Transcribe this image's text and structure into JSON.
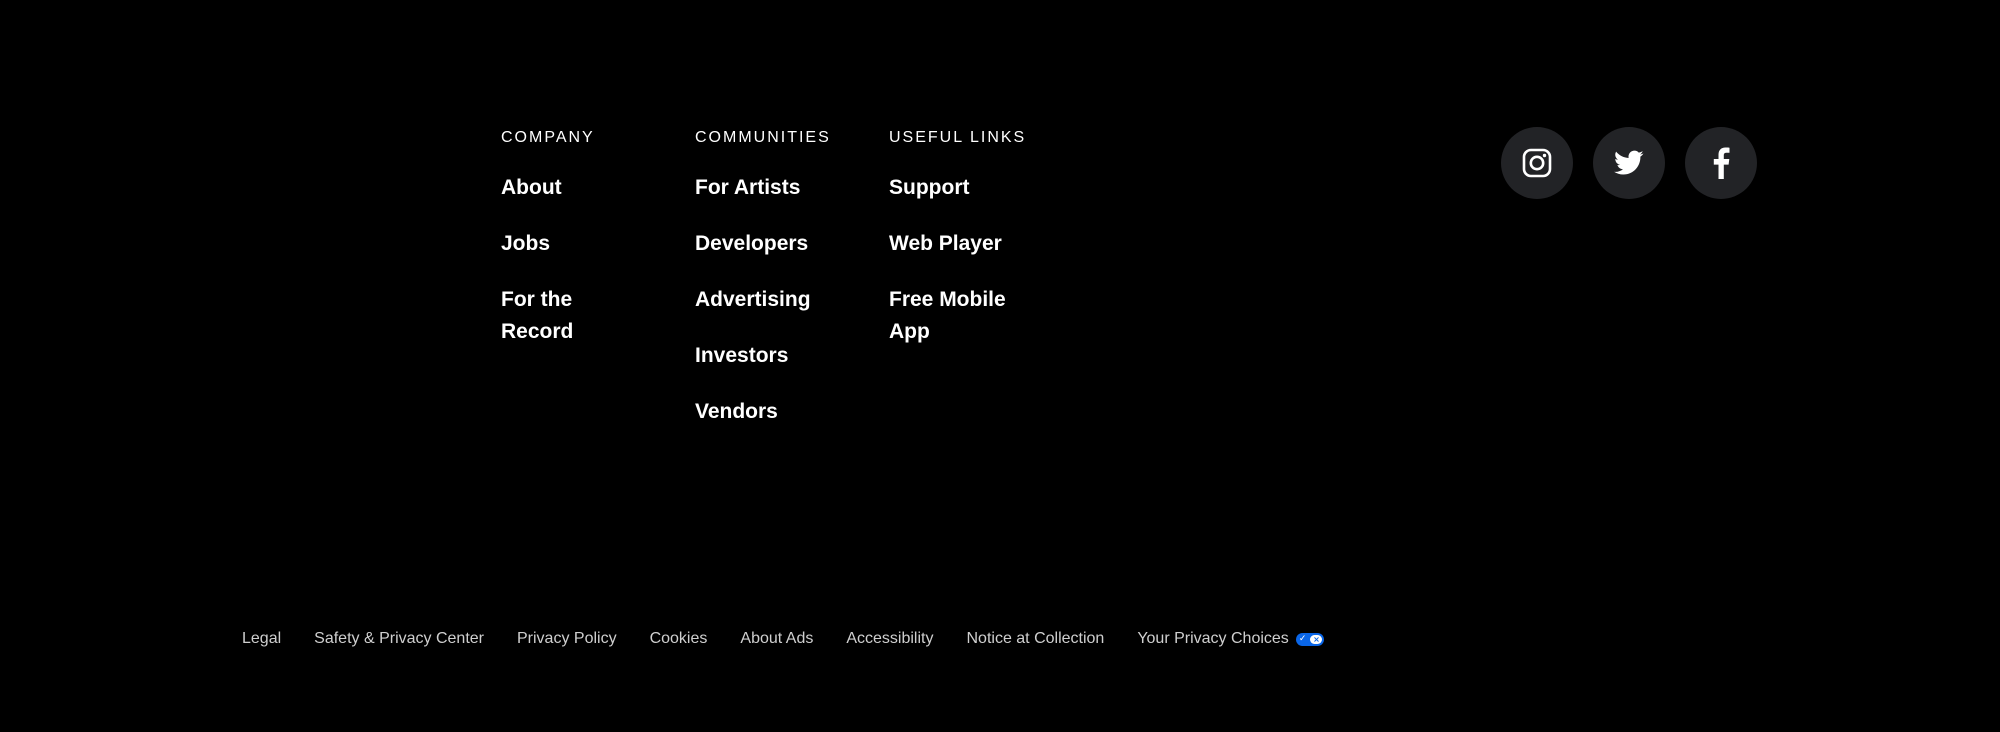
{
  "footer": {
    "columns": [
      {
        "title": "COMPANY",
        "links": [
          "About",
          "Jobs",
          "For the Record"
        ]
      },
      {
        "title": "COMMUNITIES",
        "links": [
          "For Artists",
          "Developers",
          "Advertising",
          "Investors",
          "Vendors"
        ]
      },
      {
        "title": "USEFUL LINKS",
        "links": [
          "Support",
          "Web Player",
          "Free Mobile App"
        ]
      }
    ],
    "social": [
      {
        "icon": "instagram-icon"
      },
      {
        "icon": "twitter-icon"
      },
      {
        "icon": "facebook-icon"
      }
    ],
    "legal_links": [
      "Legal",
      "Safety & Privacy Center",
      "Privacy Policy",
      "Cookies",
      "About Ads",
      "Accessibility",
      "Notice at Collection",
      "Your Privacy Choices"
    ]
  },
  "colors": {
    "background": "#000000",
    "text": "#ffffff",
    "legal_text": "#cfcfcf",
    "social_bg": "#222326",
    "privacy_toggle": "#0a66e8"
  }
}
